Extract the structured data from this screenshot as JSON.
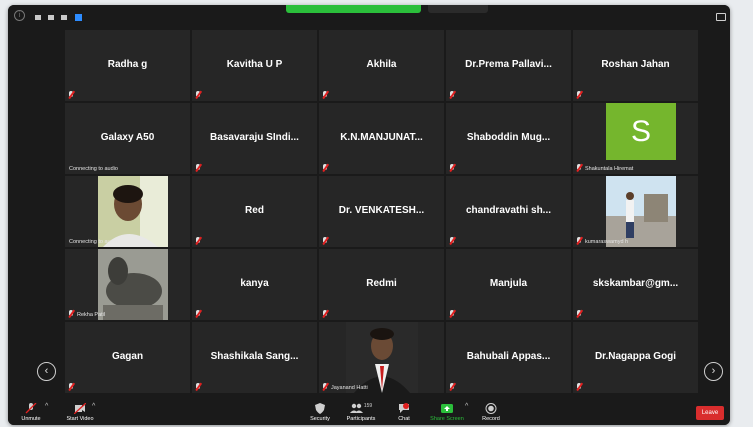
{
  "colors": {
    "background": "#1a1a1a",
    "tile": "#262626",
    "accent": "#2d8cff",
    "share": "#2bbf3b",
    "leave": "#d92d2d",
    "avatar_s": "#75b62d"
  },
  "tiles": [
    {
      "name": "Radha g"
    },
    {
      "name": "Kavitha U P"
    },
    {
      "name": "Akhila"
    },
    {
      "name": "Dr.Prema  Pallavi..."
    },
    {
      "name": "Roshan Jahan"
    },
    {
      "name": "Galaxy A50",
      "label": "Connecting to audio"
    },
    {
      "name": "Basavaraju  SIndi..."
    },
    {
      "name": "K.N.MANJUNAT..."
    },
    {
      "name": "Shaboddin  Mug..."
    },
    {
      "avatar_letter": "S",
      "label": "Shakuntala Hiremat"
    },
    {
      "label": "Connecting to audio"
    },
    {
      "name": "Red"
    },
    {
      "name": "Dr.  VENKATESH..."
    },
    {
      "name": "chandravathi  sh..."
    },
    {
      "label": "kumaraswamyd h"
    },
    {
      "label": "Rekha Patil"
    },
    {
      "name": "kanya"
    },
    {
      "name": "Redmi"
    },
    {
      "name": "Manjula"
    },
    {
      "name": "skskambar@gm..."
    },
    {
      "name": "Gagan"
    },
    {
      "name": "Shashikala  Sang..."
    },
    {
      "label": "Jayanand Hatti"
    },
    {
      "name": "Bahubali  Appas..."
    },
    {
      "name": "Dr.Nagappa  Gogi"
    }
  ],
  "toolbar": {
    "unmute": "Unmute",
    "start_video": "Start Video",
    "security": "Security",
    "participants": "Participants",
    "participants_count": "159",
    "chat": "Chat",
    "share_screen": "Share Screen",
    "record": "Record",
    "leave": "Leave"
  }
}
